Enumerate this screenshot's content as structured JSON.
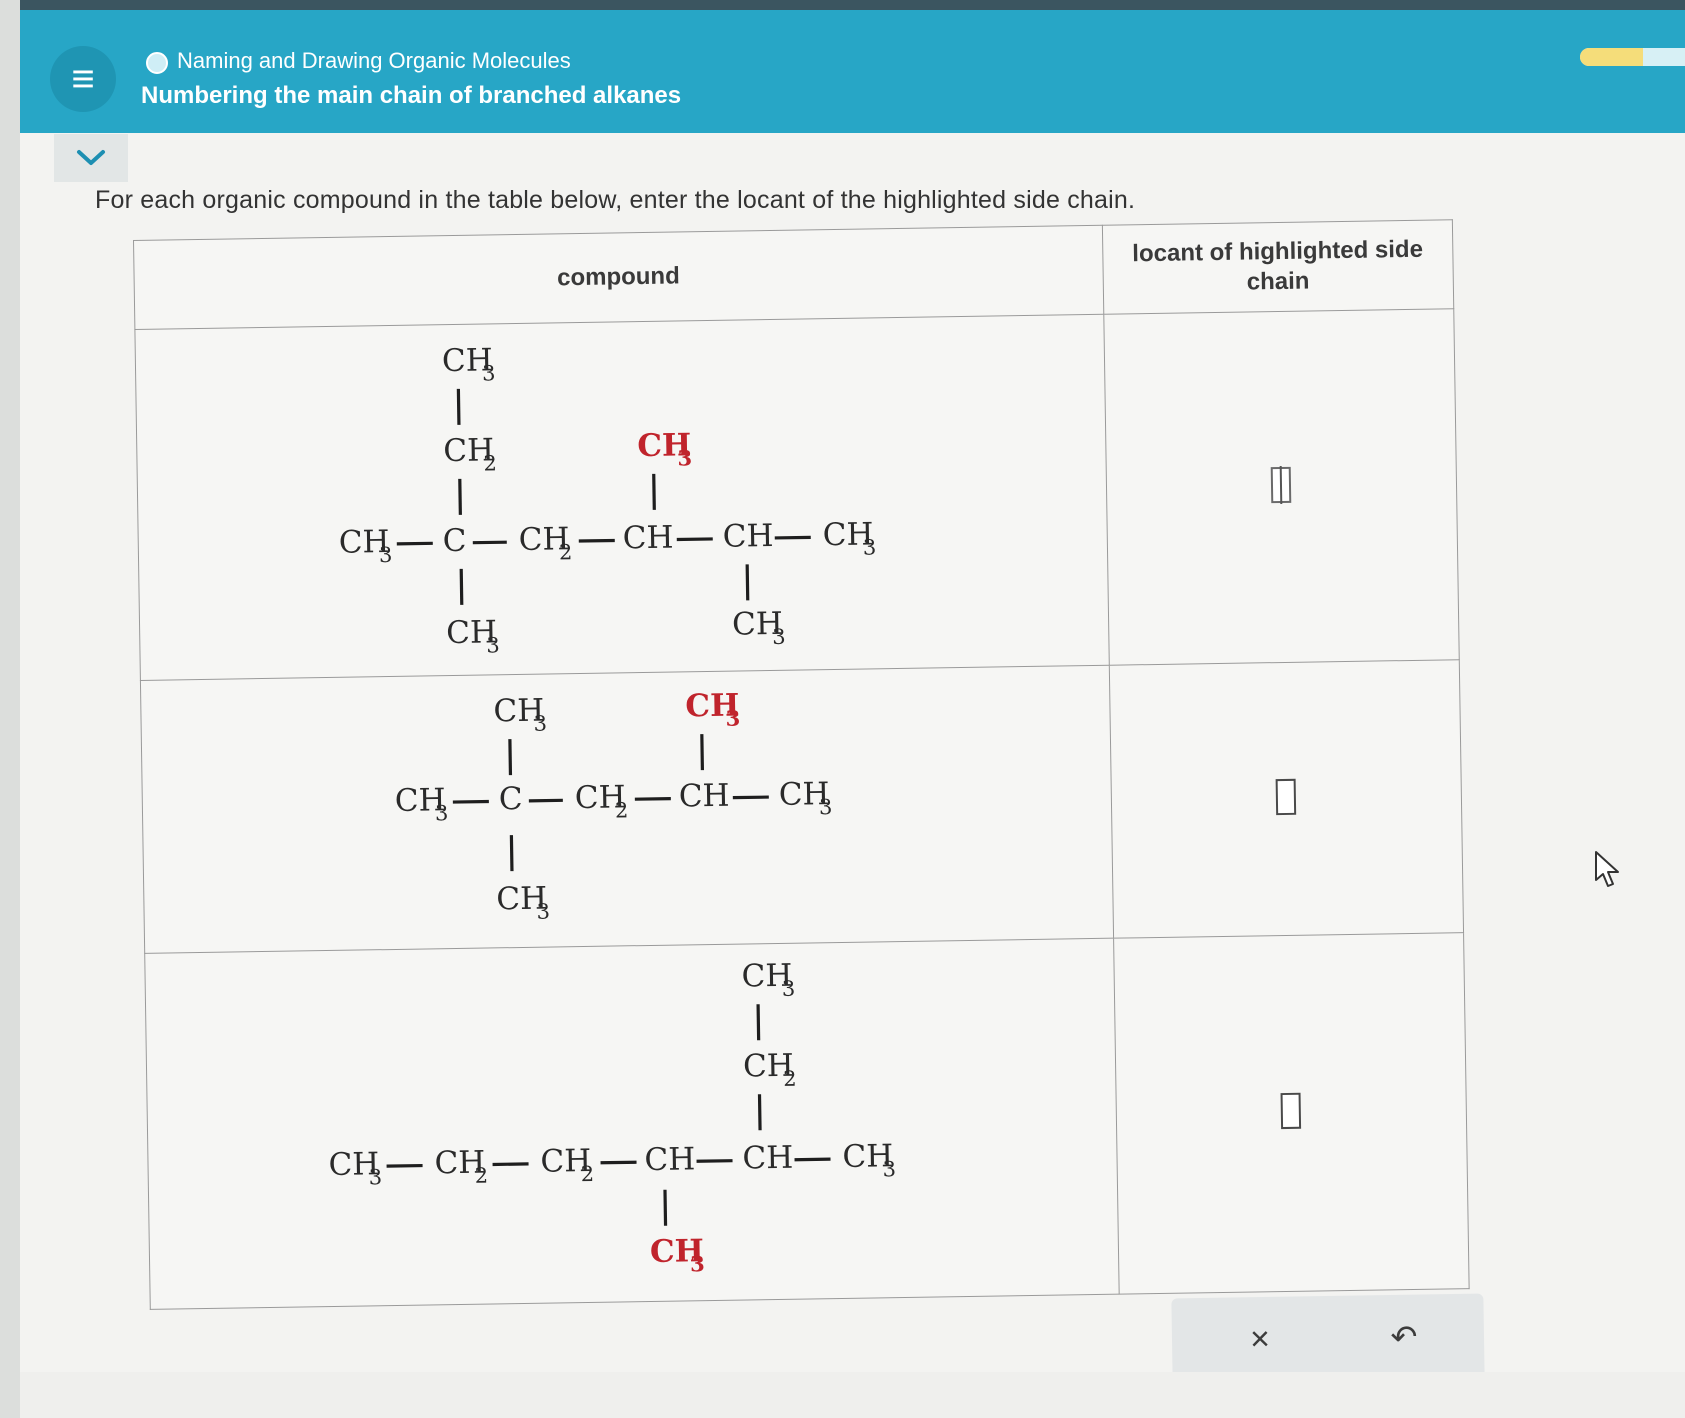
{
  "header": {
    "topic_title": "Naming and Drawing Organic Molecules",
    "lesson_title": "Numbering the main chain of branched alkanes",
    "menu_icon": "≡",
    "progress_fraction": 0.5
  },
  "instructions": "For each organic compound in the table below, enter the locant of the highlighted side chain.",
  "table": {
    "headers": {
      "compound": "compound",
      "locant": "locant of highlighted side chain"
    },
    "rows": [
      {
        "compound_label": "compound-1",
        "locant_value": "",
        "active": true
      },
      {
        "compound_label": "compound-2",
        "locant_value": "",
        "active": false
      },
      {
        "compound_label": "compound-3",
        "locant_value": "",
        "active": false
      }
    ]
  },
  "chem": {
    "ch3": "CH",
    "ch2": "CH",
    "ch": "CH",
    "c": "C",
    "sub3": "3",
    "sub2": "2"
  },
  "actions": {
    "clear_label": "×",
    "undo_label": "↶"
  },
  "colors": {
    "header_bg": "#27a6c6",
    "highlight": "#c0242c",
    "progress_fill": "#f5dd7a"
  }
}
